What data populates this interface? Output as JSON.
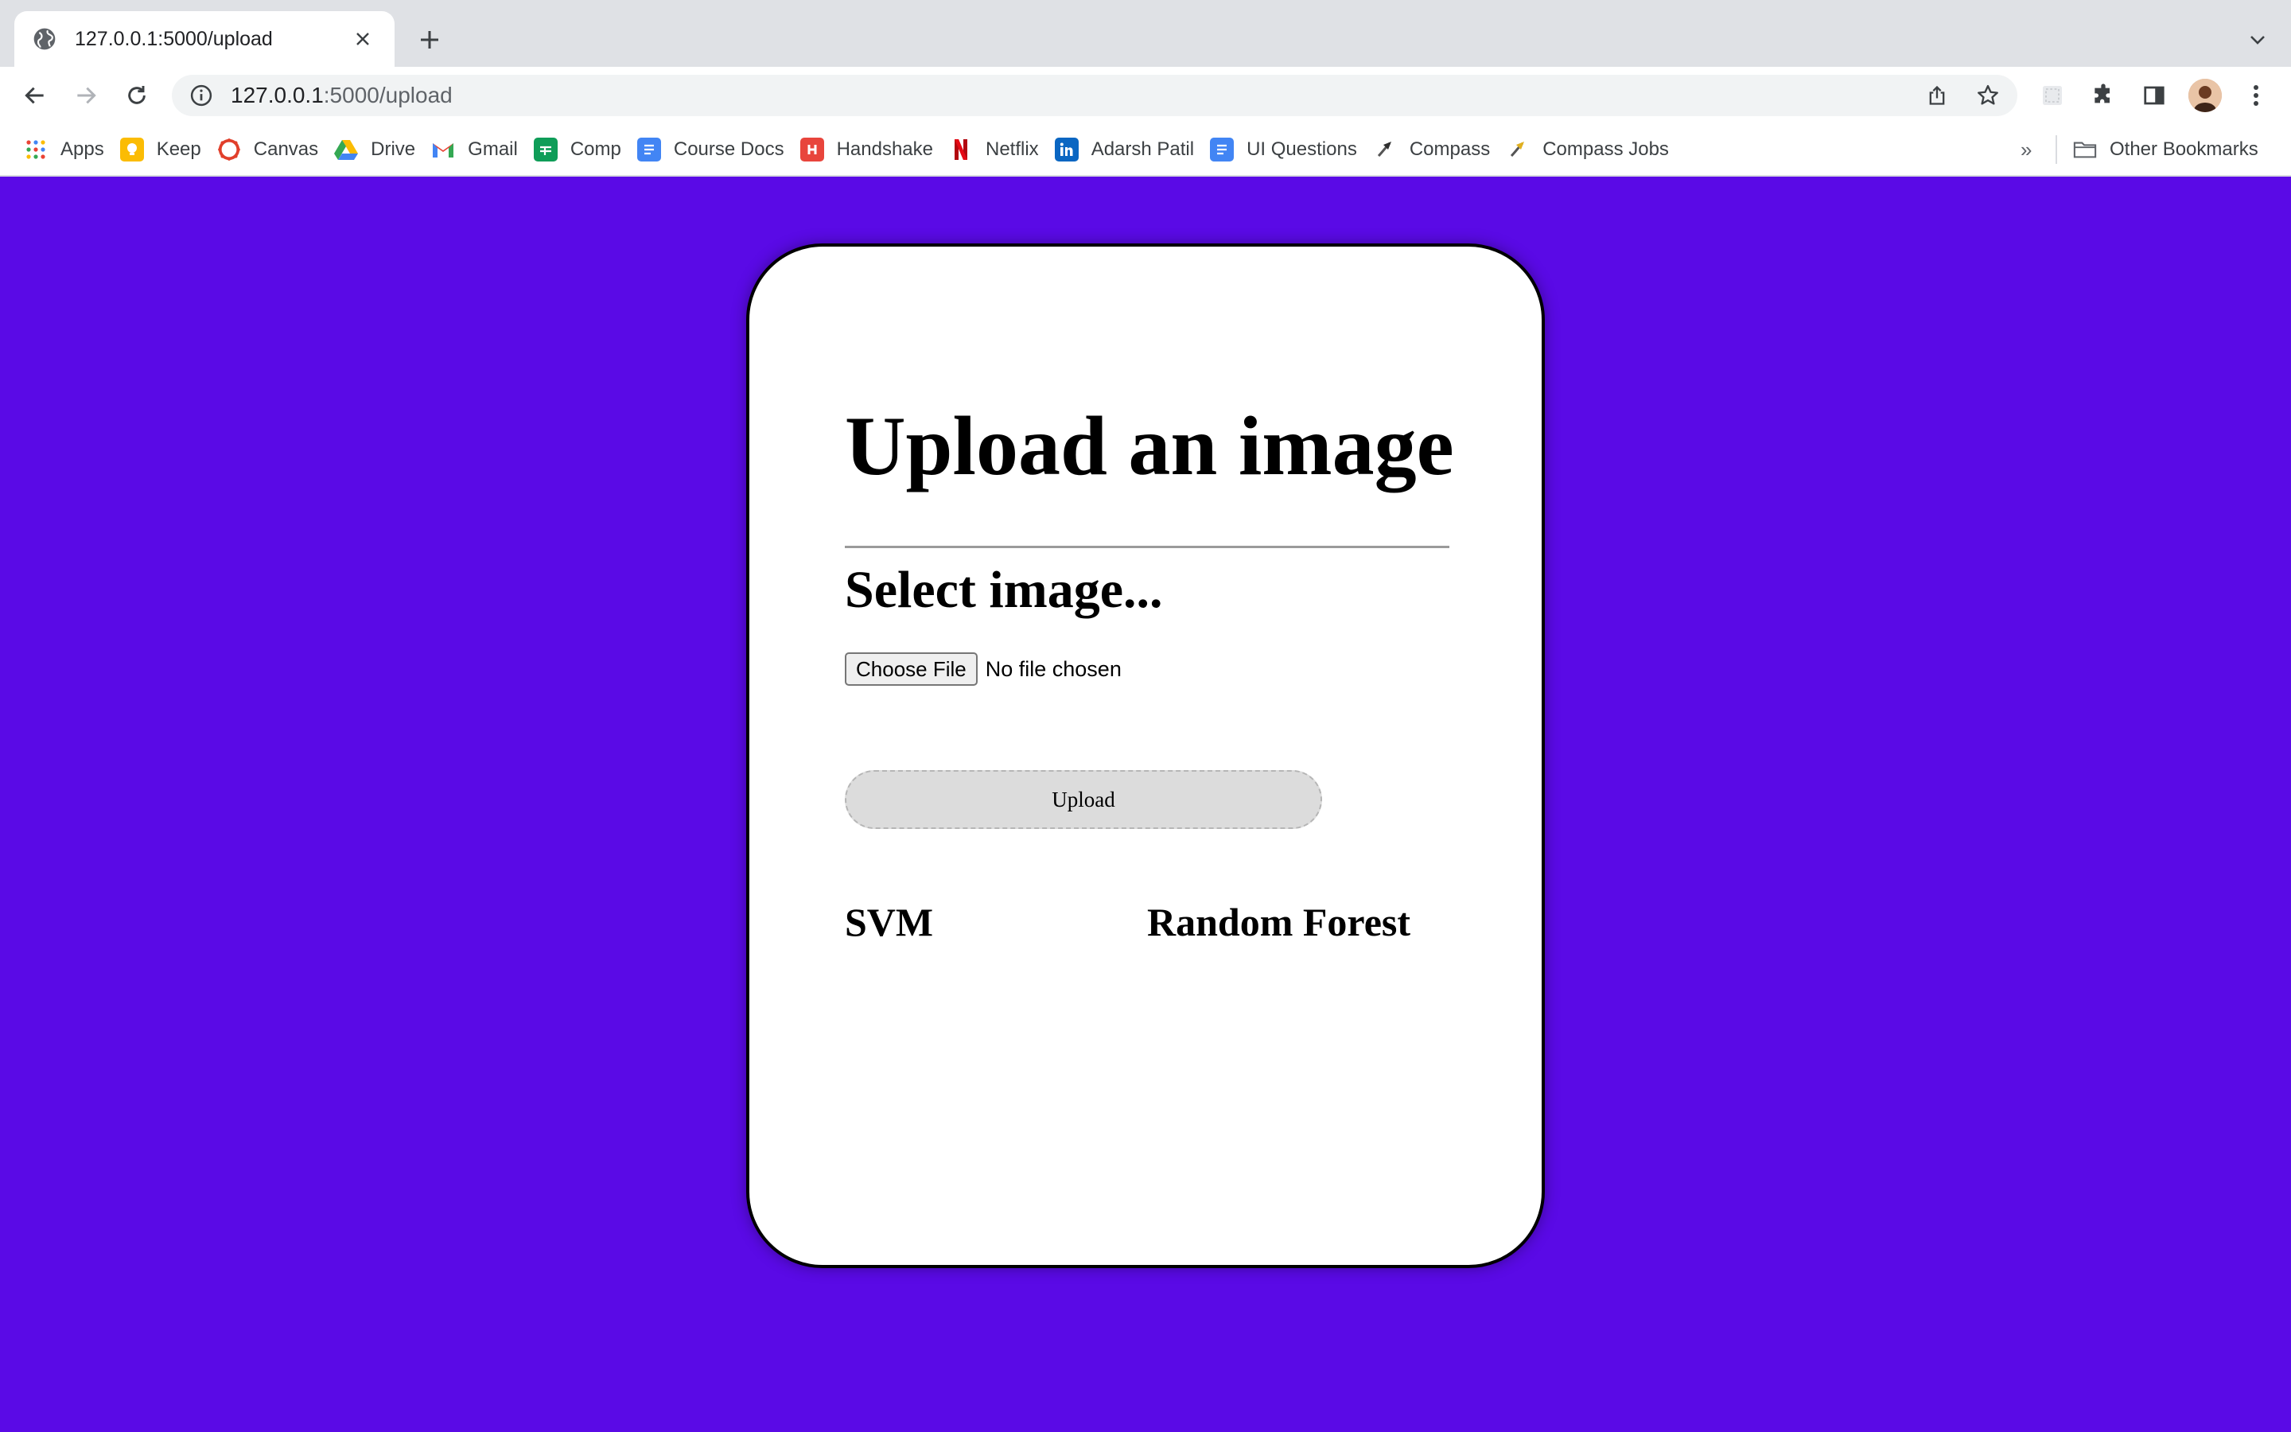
{
  "browser": {
    "tab": {
      "title": "127.0.0.1:5000/upload"
    },
    "url": {
      "host": "127.0.0.1",
      "rest": ":5000/upload"
    }
  },
  "bookmarks": {
    "items": [
      {
        "label": "Apps",
        "icon": "apps-grid-icon",
        "color": "#4285f4"
      },
      {
        "label": "Keep",
        "icon": "keep-icon",
        "color": "#fbbc04"
      },
      {
        "label": "Canvas",
        "icon": "canvas-icon",
        "color": "#e13f2b"
      },
      {
        "label": "Drive",
        "icon": "drive-icon",
        "color": "#34a853"
      },
      {
        "label": "Gmail",
        "icon": "gmail-icon",
        "color": "#ea4335"
      },
      {
        "label": "Comp",
        "icon": "sheets-icon",
        "color": "#0f9d58"
      },
      {
        "label": "Course Docs",
        "icon": "docs-icon",
        "color": "#4285f4"
      },
      {
        "label": "Handshake",
        "icon": "handshake-icon",
        "color": "#e8453c"
      },
      {
        "label": "Netflix",
        "icon": "netflix-icon",
        "color": "#e50914"
      },
      {
        "label": "Adarsh Patil",
        "icon": "linkedin-icon",
        "color": "#0a66c2"
      },
      {
        "label": "UI Questions",
        "icon": "docs-icon",
        "color": "#4285f4"
      },
      {
        "label": "Compass",
        "icon": "compass-icon",
        "color": "#555555"
      },
      {
        "label": "Compass Jobs",
        "icon": "compass-icon",
        "color": "#555555"
      }
    ],
    "more": "»",
    "other": "Other Bookmarks"
  },
  "page": {
    "background": "#5a0ae6",
    "title": "Upload an image",
    "subtitle": "Select image...",
    "file_button": "Choose File",
    "file_status": "No file chosen",
    "upload_button": "Upload",
    "results": {
      "svm": "SVM",
      "random_forest": "Random Forest"
    }
  }
}
